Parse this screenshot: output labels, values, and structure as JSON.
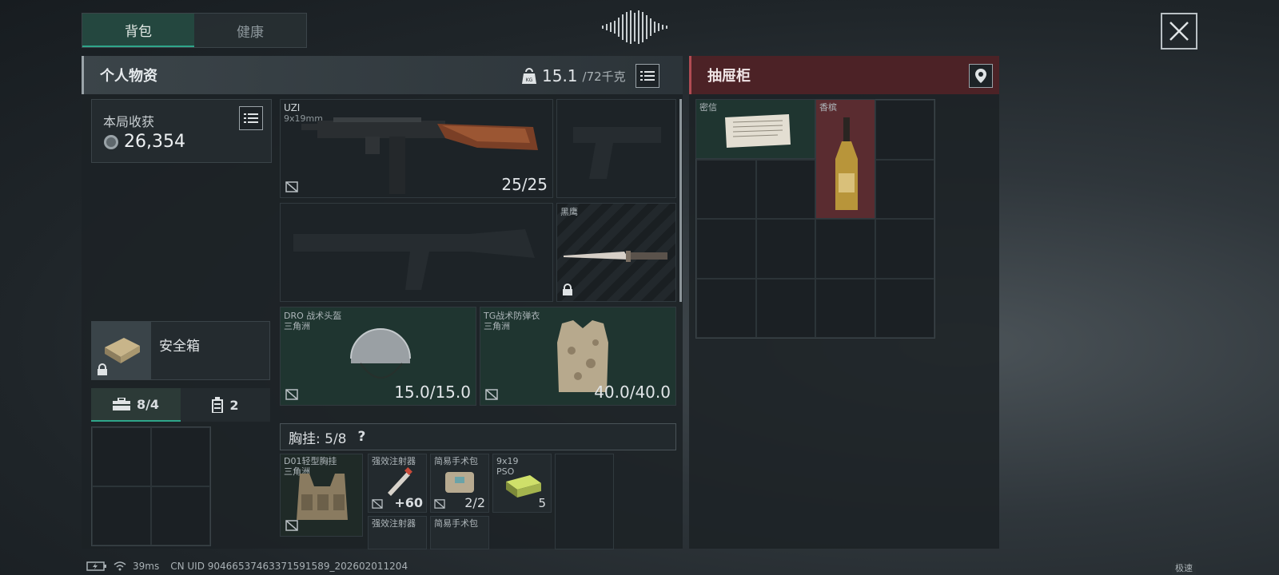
{
  "tabs": [
    "背包",
    "健康"
  ],
  "personal": {
    "title": "个人物资",
    "weight_current": "15.1",
    "weight_max": "/72千克"
  },
  "harvest": {
    "label": "本局收获",
    "value": "26,354"
  },
  "safe_box": {
    "label": "安全箱"
  },
  "counters": {
    "briefcase": "8/4",
    "canister": "2"
  },
  "items": {
    "uzi": {
      "name": "UZI",
      "ammo": "9x19mm",
      "count": "25/25"
    },
    "knife": {
      "name": "黑鹰"
    },
    "helmet": {
      "name": "DRO 战术头盔",
      "sub": "三角洲",
      "value": "15.0/15.0"
    },
    "armor": {
      "name": "TG战术防弹衣",
      "sub": "三角洲",
      "value": "40.0/40.0"
    }
  },
  "chest": {
    "label": "胸挂: 5/8",
    "help": "?",
    "items": [
      {
        "name": "D01轻型胸挂",
        "sub": "三角洲"
      },
      {
        "name": "强效注射器",
        "value": "+60"
      },
      {
        "name": "简易手术包",
        "value": "2/2"
      },
      {
        "name": "9x19 PSO",
        "value": "5"
      },
      {
        "name": "强效注射器"
      },
      {
        "name": "简易手术包"
      }
    ]
  },
  "drawer": {
    "title": "抽屉柜",
    "items": [
      {
        "name": "密信"
      },
      {
        "name": "香槟"
      }
    ]
  },
  "status_bar": {
    "ping": "39ms",
    "uid": "CN UID 90466537463371591589_202602011204",
    "corner": "极速"
  }
}
